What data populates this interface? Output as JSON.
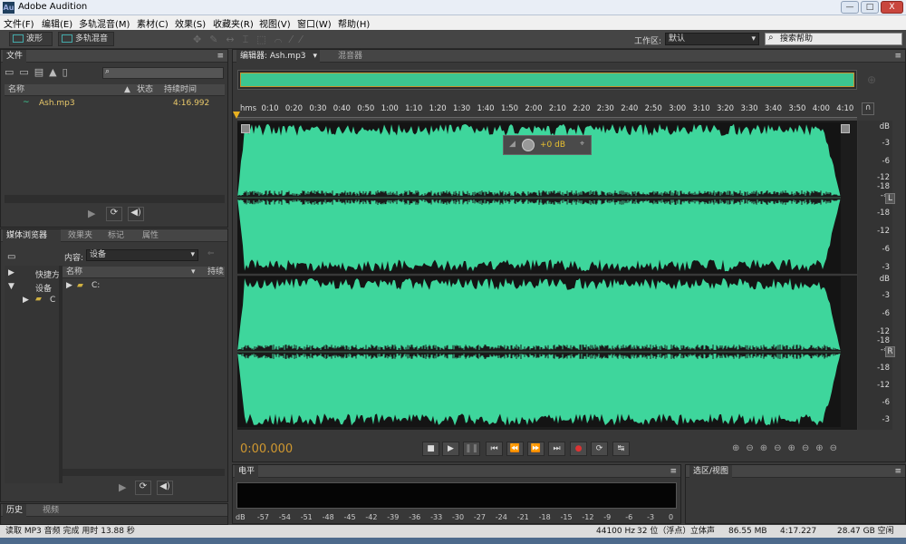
{
  "window": {
    "title": "Adobe Audition",
    "minimize": "—",
    "maximize": "□",
    "close": "X"
  },
  "menu": [
    "文件(F)",
    "编辑(E)",
    "多轨混音(M)",
    "素材(C)",
    "效果(S)",
    "收藏夹(R)",
    "视图(V)",
    "窗口(W)",
    "帮助(H)"
  ],
  "toolbar": {
    "waveform": "波形",
    "multitrack": "多轨混音",
    "workspace_label": "工作区:",
    "workspace_value": "默认",
    "search_placeholder": "搜索帮助"
  },
  "files_panel": {
    "title": "文件",
    "columns": [
      "名称",
      "状态",
      "持续时间"
    ],
    "rows": [
      {
        "name": "Ash.mp3",
        "duration": "4:16.992"
      }
    ]
  },
  "media_panel": {
    "tabs": [
      "媒体浏览器",
      "效果夹",
      "标记",
      "属性"
    ],
    "content_label": "内容:",
    "content_value": "设备",
    "tree": [
      "快捷方",
      "设备",
      "C"
    ],
    "list_header_name": "名称",
    "list_header_duration": "持续",
    "list_items": [
      "C:"
    ]
  },
  "editor": {
    "tab": "编辑器: Ash.mp3",
    "mixer_tab": "混音器",
    "ruler_start": "hms",
    "ruler": [
      "0:10",
      "0:20",
      "0:30",
      "0:40",
      "0:50",
      "1:00",
      "1:10",
      "1:20",
      "1:30",
      "1:40",
      "1:50",
      "2:00",
      "2:10",
      "2:20",
      "2:30",
      "2:40",
      "2:50",
      "3:00",
      "3:10",
      "3:20",
      "3:30",
      "3:40",
      "3:50",
      "4:00",
      "4:10"
    ],
    "db_scale_top": [
      "dB",
      "-3",
      "-6",
      "-12",
      "-18",
      "-∞",
      "-18",
      "-12",
      "-6",
      "-3"
    ],
    "db_scale_bottom": [
      "dB",
      "-3",
      "-6",
      "-12",
      "-18",
      "-∞",
      "-18",
      "-12",
      "-6",
      "-3"
    ],
    "channel_left": "L",
    "channel_right": "R",
    "hud_gain": "+0 dB",
    "time": "0:00.000",
    "waveform_color": "#3ed69c"
  },
  "levels": {
    "title": "电平",
    "scale": [
      "dB",
      "-57",
      "-54",
      "-51",
      "-48",
      "-45",
      "-42",
      "-39",
      "-36",
      "-33",
      "-30",
      "-27",
      "-24",
      "-21",
      "-18",
      "-15",
      "-12",
      "-9",
      "-6",
      "-3",
      "0"
    ]
  },
  "selection_panel": {
    "title": "选区/视图"
  },
  "history": {
    "tabs": [
      "历史",
      "视频"
    ]
  },
  "status": {
    "message": "读取 MP3 音频 完成 用时 13.88 秒",
    "sample_rate": "44100 Hz",
    "bit_depth": "32 位（浮点）",
    "channels": "立体声",
    "size": "86.55 MB",
    "duration": "4:17.227",
    "free": "28.47 GB 空闲"
  }
}
